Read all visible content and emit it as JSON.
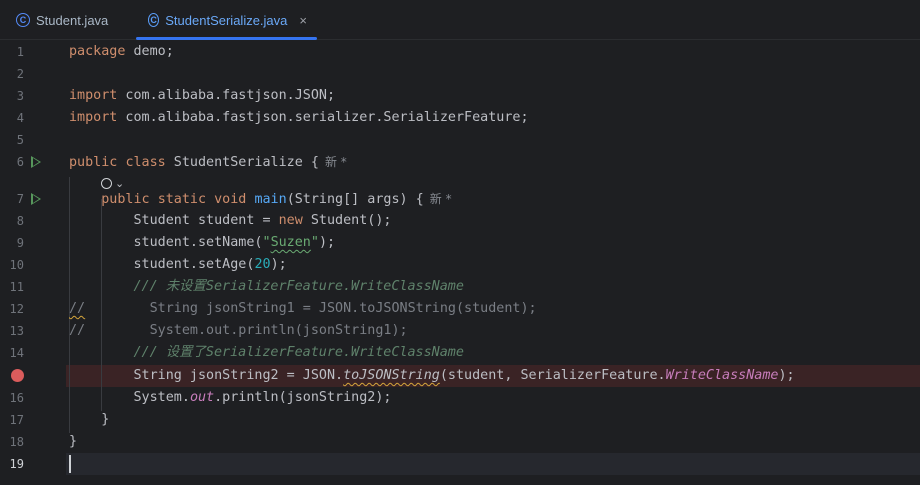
{
  "tabs": [
    {
      "label": "Student.java",
      "active": false
    },
    {
      "label": "StudentSerialize.java",
      "active": true,
      "close": "×"
    }
  ],
  "tab_icon_letter": "C",
  "line_numbers": [
    "1",
    "2",
    "3",
    "4",
    "5",
    "6",
    "7",
    "8",
    "9",
    "10",
    "11",
    "12",
    "13",
    "14",
    "15",
    "16",
    "17",
    "18",
    "19"
  ],
  "code": {
    "l1_kw": "package",
    "l1_rest": " demo;",
    "l3_kw": "import",
    "l3_rest": " com.alibaba.fastjson.JSON;",
    "l4_kw": "import",
    "l4_rest": " com.alibaba.fastjson.serializer.SerializerFeature;",
    "l6_kw1": "public",
    "l6_kw2": "class",
    "l6_name": " StudentSerialize {",
    "l6_hint": "新 *",
    "l7_kw1": "public",
    "l7_kw2": "static",
    "l7_kw3": "void",
    "l7_fn": "main",
    "l7_rest": "(String[] args) {",
    "l7_hint": "新 *",
    "l8_a": "Student student = ",
    "l8_kw": "new",
    "l8_b": " Student();",
    "l9_a": "student.setName(",
    "l9_str_q1": "\"",
    "l9_str_v": "Suzen",
    "l9_str_q2": "\"",
    "l9_b": ");",
    "l10_a": "student.setAge(",
    "l10_num": "20",
    "l10_b": ");",
    "l11_doc": "/// 未设置SerializerFeature.WriteClassName",
    "l12_slash": "//",
    "l12_rest": "        String jsonString1 = JSON.toJSONString(student);",
    "l13_cmt": "//        System.out.println(jsonString1);",
    "l14_doc": "/// 设置了SerializerFeature.WriteClassName",
    "l15_a": "String jsonString2 = JSON.",
    "l15_m": "toJSONString",
    "l15_b": "(student, SerializerFeature.",
    "l15_static": "WriteClassName",
    "l15_c": ");",
    "l16_a": "System.",
    "l16_static": "out",
    "l16_b": ".println(jsonString2);",
    "l17": "}",
    "l18": "}"
  },
  "inlay_chevron": "⌄"
}
